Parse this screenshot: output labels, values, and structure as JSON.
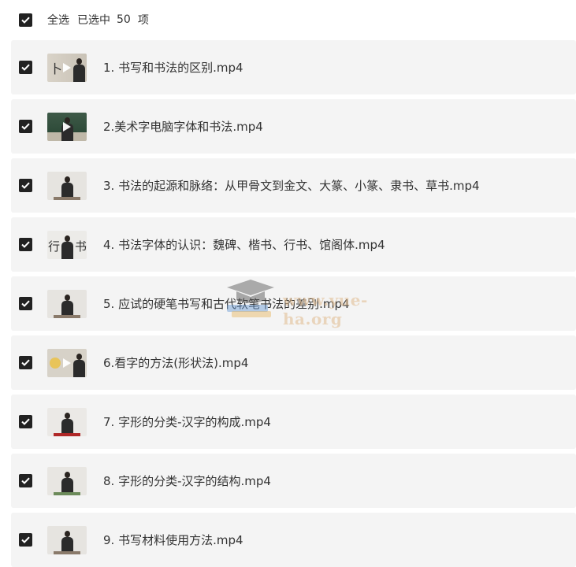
{
  "header": {
    "select_all_label": "全选",
    "selected_label": "已选中",
    "selected_count": "50",
    "count_unit": "项",
    "checked": true
  },
  "files": [
    {
      "name": "1. 书写和书法的区别.mp4",
      "checked": true,
      "thumb_style": "calligraphy-play"
    },
    {
      "name": "2.美术字电脑字体和书法.mp4",
      "checked": true,
      "thumb_style": "green-board"
    },
    {
      "name": "3. 书法的起源和脉络：从甲骨文到金文、大篆、小篆、隶书、草书.mp4",
      "checked": true,
      "thumb_style": "lecturer"
    },
    {
      "name": "4. 书法字体的认识：魏碑、楷书、行书、馆阁体.mp4",
      "checked": true,
      "thumb_style": "lecturer-chars"
    },
    {
      "name": "5. 应试的硬笔书写和古代软笔书法的差别.mp4",
      "checked": true,
      "thumb_style": "lecturer"
    },
    {
      "name": "6.看字的方法(形状法).mp4",
      "checked": true,
      "thumb_style": "calligraphy-play"
    },
    {
      "name": "7. 字形的分类-汉字的构成.mp4",
      "checked": true,
      "thumb_style": "lecturer"
    },
    {
      "name": "8. 字形的分类-汉字的结构.mp4",
      "checked": true,
      "thumb_style": "lecturer"
    },
    {
      "name": "9. 书写材料使用方法.mp4",
      "checked": true,
      "thumb_style": "lecturer"
    }
  ],
  "watermark": {
    "text": "www.yue-ha.org",
    "icon": "graduation-cap-icon"
  },
  "colors": {
    "row_background": "#f4f4f4",
    "checkbox": "#222222",
    "text": "#333333"
  }
}
